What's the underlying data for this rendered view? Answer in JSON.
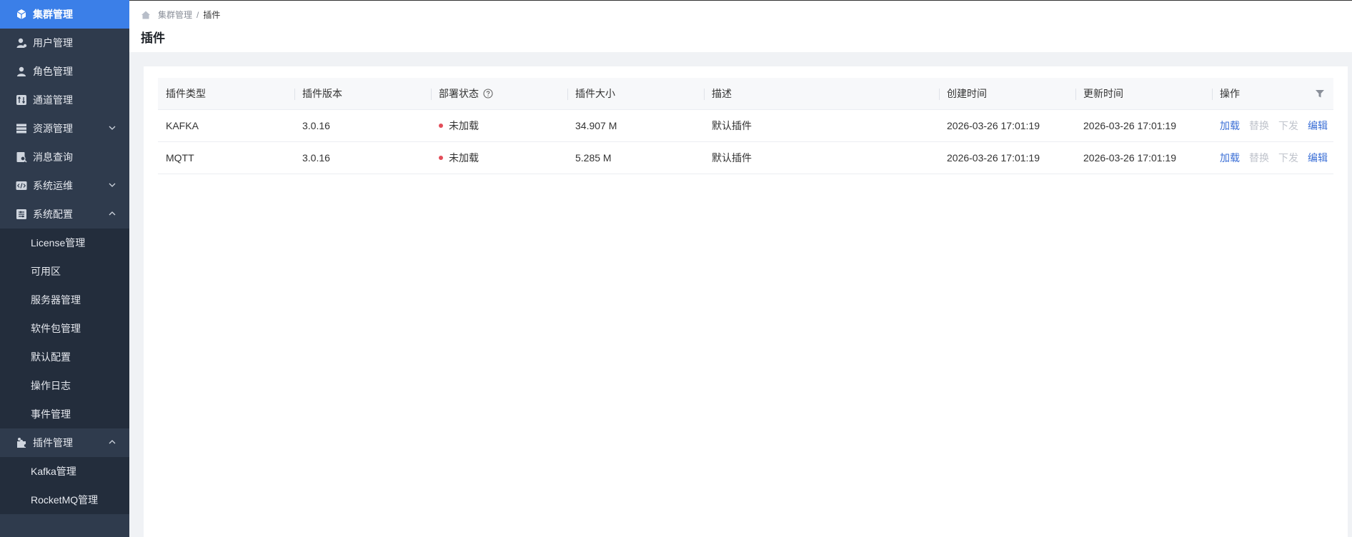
{
  "sidebar": {
    "items": [
      {
        "label": "集群管理",
        "icon": "cube-icon",
        "active": true
      },
      {
        "label": "用户管理",
        "icon": "user-icon"
      },
      {
        "label": "角色管理",
        "icon": "role-icon"
      },
      {
        "label": "通道管理",
        "icon": "channel-icon"
      },
      {
        "label": "资源管理",
        "icon": "server-icon",
        "expanded": false
      },
      {
        "label": "消息查询",
        "icon": "message-search-icon"
      },
      {
        "label": "系统运维",
        "icon": "code-icon",
        "expanded": false
      },
      {
        "label": "系统配置",
        "icon": "config-icon",
        "expanded": true
      },
      {
        "label": "插件管理",
        "icon": "plugin-icon",
        "expanded": true
      }
    ],
    "system_config_children": [
      "License管理",
      "可用区",
      "服务器管理",
      "软件包管理",
      "默认配置",
      "操作日志",
      "事件管理"
    ],
    "plugin_children": [
      "Kafka管理",
      "RocketMQ管理"
    ]
  },
  "breadcrumb": {
    "parent": "集群管理",
    "separator": "/",
    "current": "插件"
  },
  "page": {
    "title": "插件"
  },
  "table": {
    "columns": [
      "插件类型",
      "插件版本",
      "部署状态",
      "插件大小",
      "描述",
      "创建时间",
      "更新时间",
      "操作"
    ],
    "rows": [
      {
        "type": "KAFKA",
        "version": "3.0.16",
        "status": "未加载",
        "size": "34.907 M",
        "desc": "默认插件",
        "created": "2026-03-26 17:01:19",
        "updated": "2026-03-26 17:01:19"
      },
      {
        "type": "MQTT",
        "version": "3.0.16",
        "status": "未加载",
        "size": "5.285 M",
        "desc": "默认插件",
        "created": "2026-03-26 17:01:19",
        "updated": "2026-03-26 17:01:19"
      }
    ],
    "actions": {
      "load": "加载",
      "replace": "替换",
      "deploy": "下发",
      "edit": "编辑"
    }
  },
  "colors": {
    "sidebar_bg": "#2f3b4d",
    "active_bg": "#3b7fe8",
    "link": "#3b6fd6",
    "status_unloaded": "#e34d59"
  }
}
